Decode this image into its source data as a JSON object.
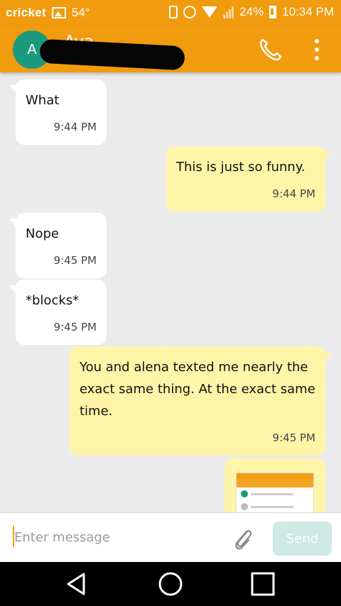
{
  "status_bar": {
    "carrier": "cricket",
    "temperature": "54°",
    "battery": "24%",
    "time": "10:34 PM",
    "icons": [
      "image-icon",
      "vibrate-icon",
      "alarm-icon",
      "wifi-icon",
      "signal-icon",
      "battery-charging-icon"
    ]
  },
  "header": {
    "avatar_letter": "A",
    "contact_name": "Ava",
    "icons": [
      "phone-icon",
      "more-vert-icon"
    ]
  },
  "messages": [
    {
      "direction": "incoming",
      "text": "What",
      "time": "9:44 PM"
    },
    {
      "direction": "outgoing",
      "text": "This is just so funny.",
      "time": "9:44 PM"
    },
    {
      "direction": "incoming",
      "text": "Nope",
      "time": "9:45 PM"
    },
    {
      "direction": "incoming",
      "text": "*blocks*",
      "time": "9:45 PM"
    },
    {
      "direction": "outgoing",
      "text": "You and alena texted me nearly the exact same thing. At the exact same time.",
      "time": "9:45 PM"
    }
  ],
  "composer": {
    "placeholder": "Enter message",
    "send_label": "Send"
  },
  "colors": {
    "brand": "#f19b0f",
    "incoming_bubble": "#ffffff",
    "outgoing_bubble": "#fff5a8",
    "avatar": "#1c9a7e",
    "send_disabled": "#cfe9e5"
  },
  "nav_icons": [
    "back-icon",
    "home-icon",
    "recents-icon"
  ]
}
